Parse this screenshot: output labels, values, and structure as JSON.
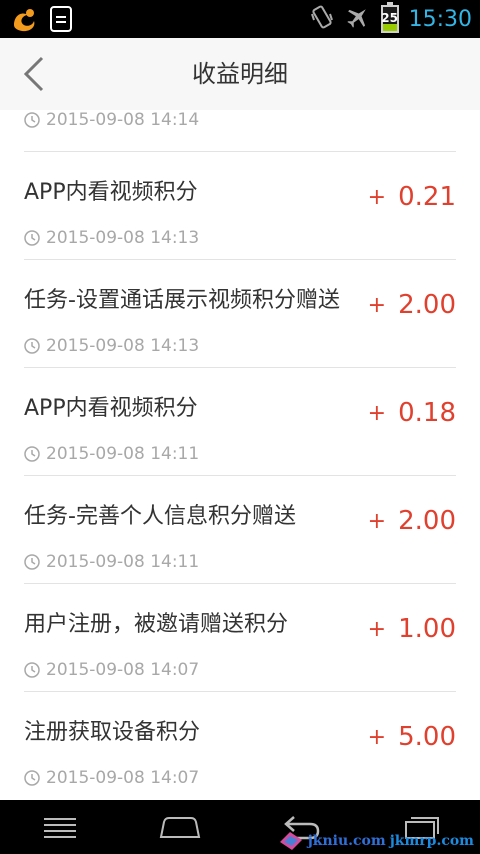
{
  "status_bar": {
    "time": "15:30",
    "battery_level": "25",
    "icons": [
      "uc-browser-icon",
      "document-icon",
      "vibrate-icon",
      "airplane-mode-icon",
      "battery-icon"
    ]
  },
  "header": {
    "title": "收益明细",
    "back_icon": "chevron-left-icon"
  },
  "list": {
    "partial_item": {
      "time": "2015-09-08 14:14"
    },
    "items": [
      {
        "title": "APP内看视频积分",
        "time": "2015-09-08 14:13",
        "sign": "+",
        "amount": "0.21"
      },
      {
        "title": "任务-设置通话展示视频积分赠送",
        "time": "2015-09-08 14:13",
        "sign": "+",
        "amount": "2.00"
      },
      {
        "title": "APP内看视频积分",
        "time": "2015-09-08 14:11",
        "sign": "+",
        "amount": "0.18"
      },
      {
        "title": "任务-完善个人信息积分赠送",
        "time": "2015-09-08 14:11",
        "sign": "+",
        "amount": "2.00"
      },
      {
        "title": "用户注册，被邀请赠送积分",
        "time": "2015-09-08 14:07",
        "sign": "+",
        "amount": "1.00"
      },
      {
        "title": "注册获取设备积分",
        "time": "2015-09-08 14:07",
        "sign": "+",
        "amount": "5.00"
      }
    ]
  },
  "nav_bar": {
    "icons": [
      "menu-icon",
      "home-icon",
      "back-icon",
      "recent-apps-icon"
    ]
  },
  "watermark": {
    "text_a": "jkniu.com",
    "text_b": "jkmrp.com"
  },
  "colors": {
    "amount": "#e0402e",
    "clock": "#33b5e5",
    "time_text": "#a8a8a8"
  }
}
